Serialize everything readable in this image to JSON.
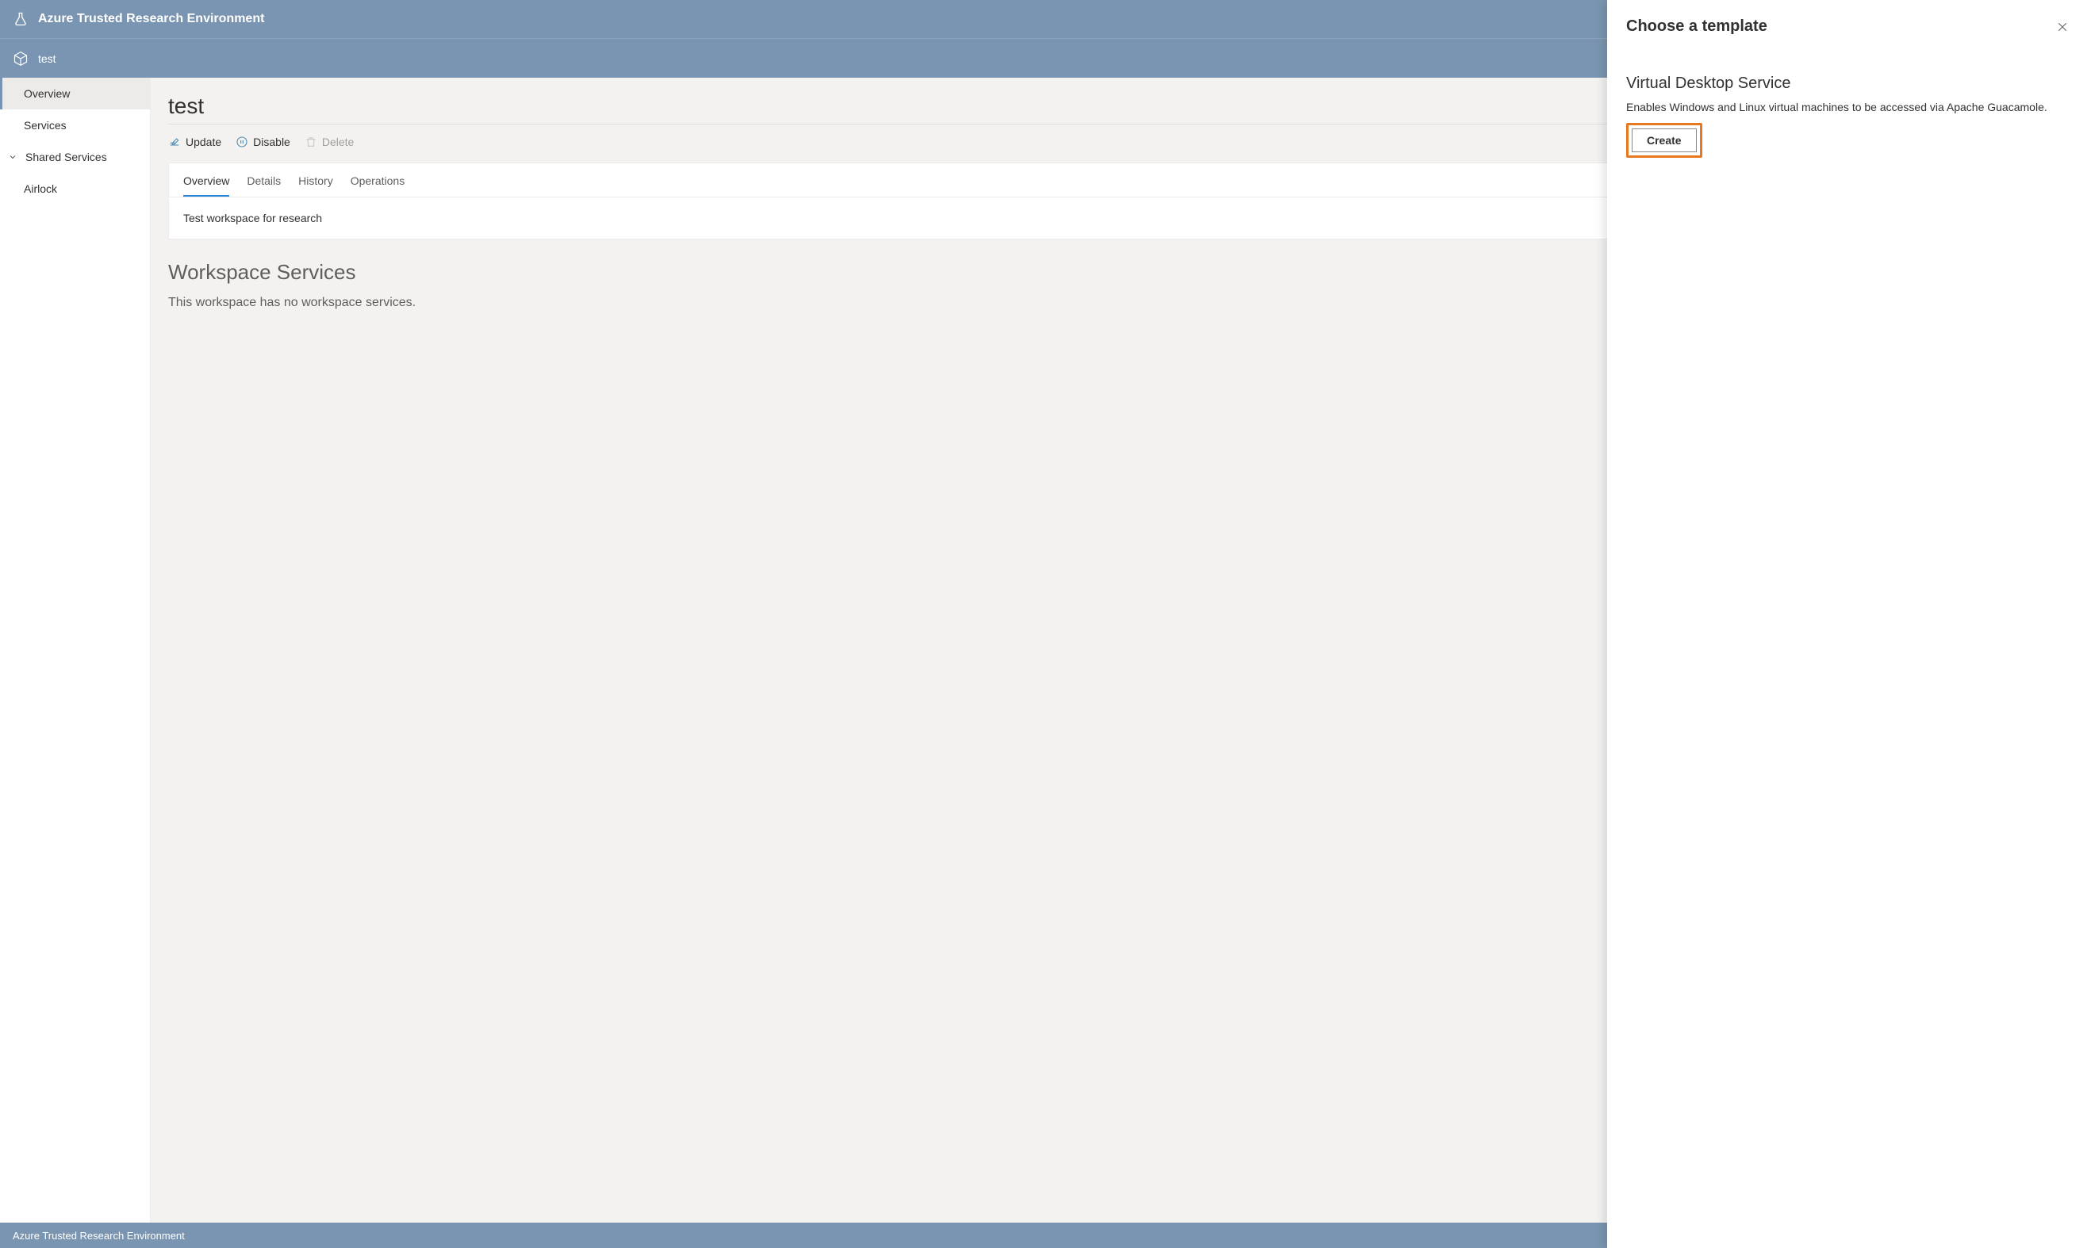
{
  "header": {
    "product_name": "Azure Trusted Research Environment"
  },
  "breadcrumb": {
    "workspace_name": "test"
  },
  "sidebar": {
    "items": [
      {
        "label": "Overview",
        "active": true
      },
      {
        "label": "Services",
        "active": false
      },
      {
        "label": "Shared Services",
        "active": false,
        "chevron": true
      },
      {
        "label": "Airlock",
        "active": false
      }
    ]
  },
  "main": {
    "page_title": "test",
    "commands": {
      "update": "Update",
      "disable": "Disable",
      "delete": "Delete"
    },
    "tabs": [
      {
        "label": "Overview",
        "active": true
      },
      {
        "label": "Details",
        "active": false
      },
      {
        "label": "History",
        "active": false
      },
      {
        "label": "Operations",
        "active": false
      }
    ],
    "overview_text": "Test workspace for research",
    "services_heading": "Workspace Services",
    "services_empty_text": "This workspace has no workspace services."
  },
  "footer": {
    "text": "Azure Trusted Research Environment"
  },
  "panel": {
    "title": "Choose a template",
    "template_name": "Virtual Desktop Service",
    "template_description": "Enables Windows and Linux virtual machines to be accessed via Apache Guacamole.",
    "create_label": "Create"
  },
  "colors": {
    "brand_bar": "#7a95b1",
    "highlight_border": "#e8781f",
    "tab_active": "#2b88d8"
  }
}
